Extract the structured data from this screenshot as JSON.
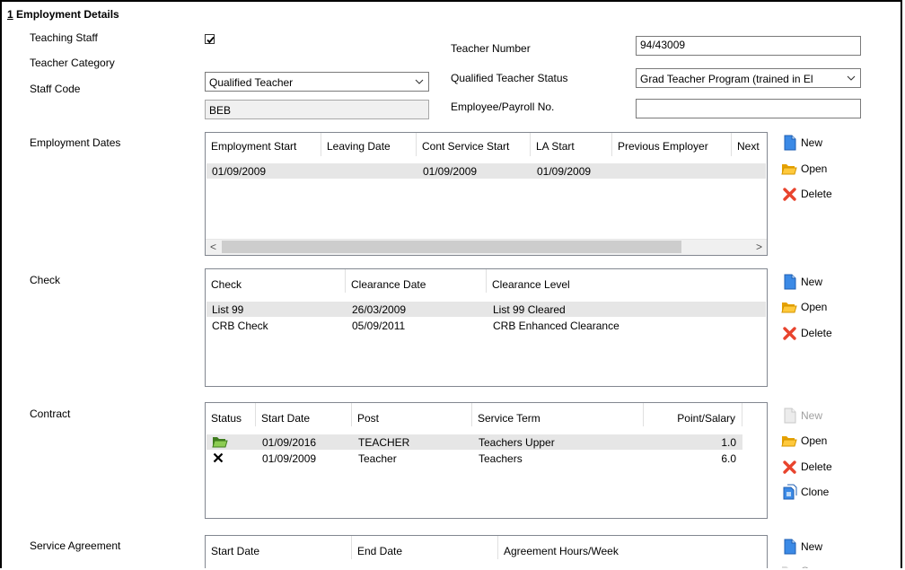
{
  "section": {
    "number": "1",
    "title": " Employment Details"
  },
  "labels": {
    "teaching_staff": "Teaching Staff",
    "teacher_category": "Teacher Category",
    "staff_code": "Staff Code",
    "teacher_number": "Teacher Number",
    "qts": "Qualified Teacher Status",
    "payroll": "Employee/Payroll No.",
    "employment_dates": "Employment Dates",
    "check": "Check",
    "contract": "Contract",
    "service_agreement": "Service Agreement"
  },
  "values": {
    "teaching_staff_checked": true,
    "teacher_category": "Qualified Teacher",
    "staff_code": "BEB",
    "teacher_number": "94/43009",
    "qts": "Grad Teacher Program (trained in El",
    "payroll": ""
  },
  "actions": {
    "new": "New",
    "open": "Open",
    "delete": "Delete",
    "clone": "Clone"
  },
  "employment_grid": {
    "headers": [
      "Employment Start",
      "Leaving Date",
      "Cont Service Start",
      "LA Start",
      "Previous Employer",
      "Next"
    ],
    "rows": [
      [
        "01/09/2009",
        "",
        "01/09/2009",
        "01/09/2009",
        "",
        ""
      ]
    ],
    "scroll_left": "<",
    "scroll_right": ">"
  },
  "check_grid": {
    "headers": [
      "Check",
      "Clearance Date",
      "Clearance Level"
    ],
    "rows": [
      [
        "List 99",
        "26/03/2009",
        "List 99 Cleared"
      ],
      [
        "CRB Check",
        "05/09/2011",
        "CRB Enhanced Clearance"
      ]
    ]
  },
  "contract_grid": {
    "headers": [
      "Status",
      "Start Date",
      "Post",
      "Service Term",
      "Point/Salary"
    ],
    "rows": [
      {
        "status_icon": "open-folder-icon",
        "start": "01/09/2016",
        "post": "TEACHER",
        "term": "Teachers Upper",
        "point": "1.0"
      },
      {
        "status_icon": "cross-icon",
        "start": "01/09/2009",
        "post": "Teacher",
        "term": "Teachers",
        "point": "6.0"
      }
    ]
  },
  "service_grid": {
    "headers": [
      "Start Date",
      "End Date",
      "Agreement Hours/Week"
    ]
  },
  "colors": {
    "folder": "#f5b400",
    "new_blue": "#2b79d6",
    "delete_red": "#e8442e",
    "disabled": "#a0a0a0"
  }
}
